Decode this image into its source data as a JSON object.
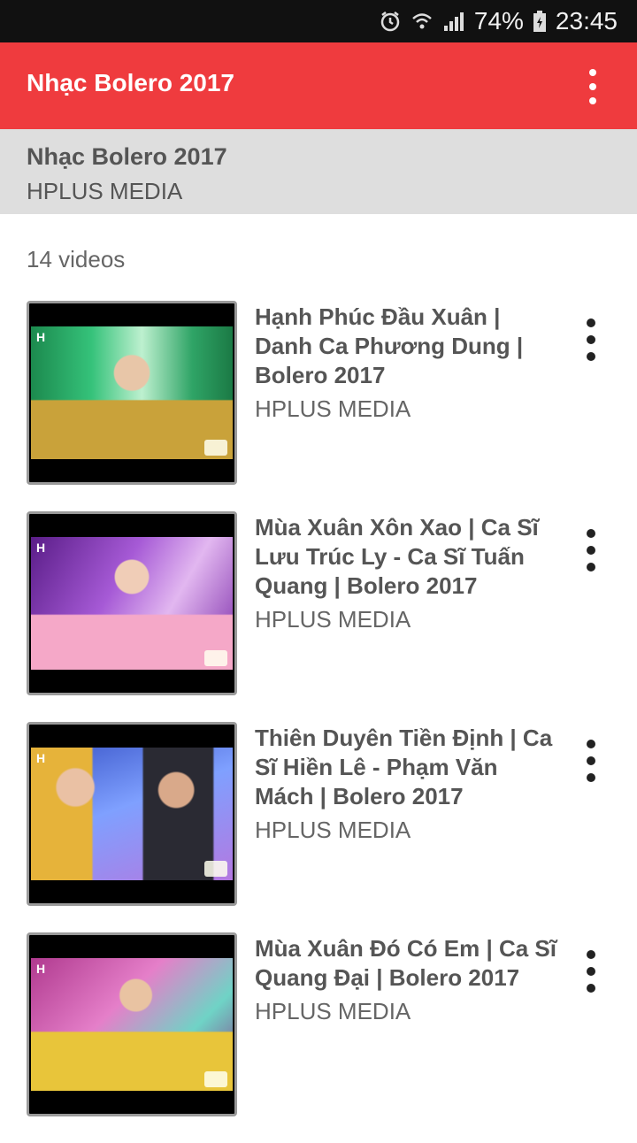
{
  "status_bar": {
    "battery": "74%",
    "time": "23:45"
  },
  "app_bar": {
    "title": "Nhạc Bolero 2017"
  },
  "playlist": {
    "title": "Nhạc Bolero 2017",
    "channel": "HPLUS MEDIA"
  },
  "video_count": "14 videos",
  "videos": [
    {
      "title": "Hạnh Phúc Đầu Xuân | Danh Ca Phương Dung | Bolero 2017",
      "channel": "HPLUS MEDIA"
    },
    {
      "title": "Mùa Xuân Xôn Xao | Ca Sĩ Lưu Trúc Ly -  Ca Sĩ Tuấn Quang | Bolero 2017",
      "channel": "HPLUS MEDIA"
    },
    {
      "title": "Thiên Duyên Tiền Định | Ca Sĩ  Hiền Lê - Phạm Văn Mách | Bolero 2017",
      "channel": "HPLUS MEDIA"
    },
    {
      "title": "Mùa Xuân Đó Có Em | Ca Sĩ Quang Đại | Bolero 2017",
      "channel": "HPLUS MEDIA"
    }
  ],
  "thumbnail_logo": "H",
  "colors": {
    "app_bar": "#ef3b3e",
    "header_panel": "#dedede",
    "status_bar": "#111111"
  },
  "icons": [
    "alarm-icon",
    "wifi-icon",
    "signal-icon",
    "battery-icon",
    "overflow-menu-icon",
    "item-more-icon"
  ]
}
